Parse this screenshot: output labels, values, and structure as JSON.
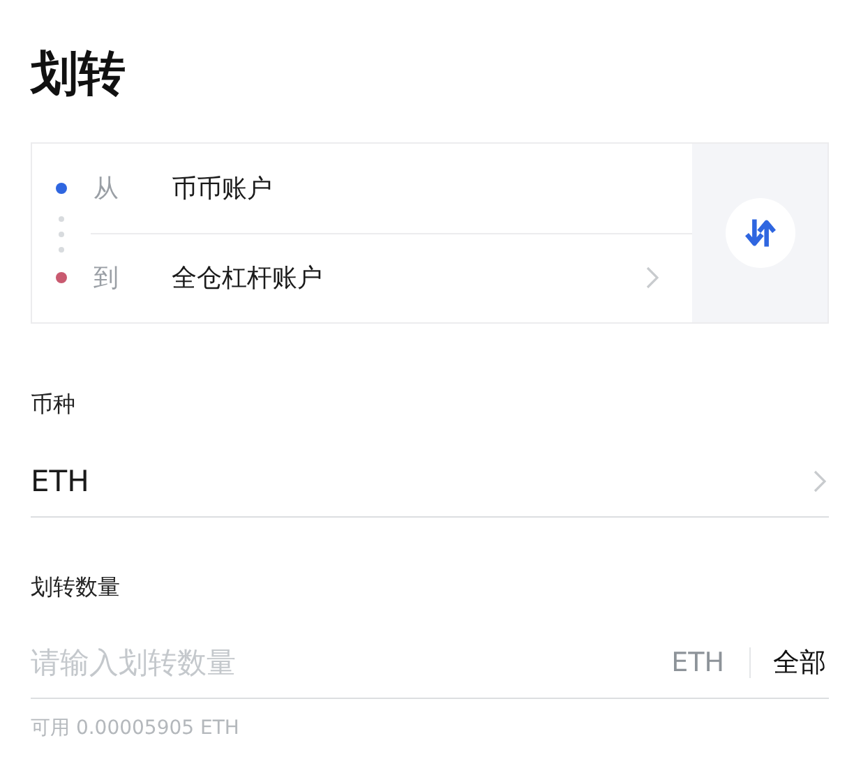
{
  "title": "划转",
  "transfer": {
    "accounts": [
      {
        "label": "从",
        "account": "币币账户",
        "color": "#2f66e0",
        "chevron": false
      },
      {
        "label": "到",
        "account": "全仓杠杆账户",
        "color": "#c95a70",
        "chevron": true
      }
    ]
  },
  "coin": {
    "label": "币种",
    "value": "ETH"
  },
  "amount": {
    "label": "划转数量",
    "placeholder": "请输入划转数量",
    "unit": "ETH",
    "all_button": "全部",
    "available": "可用 0.00005905 ETH"
  }
}
